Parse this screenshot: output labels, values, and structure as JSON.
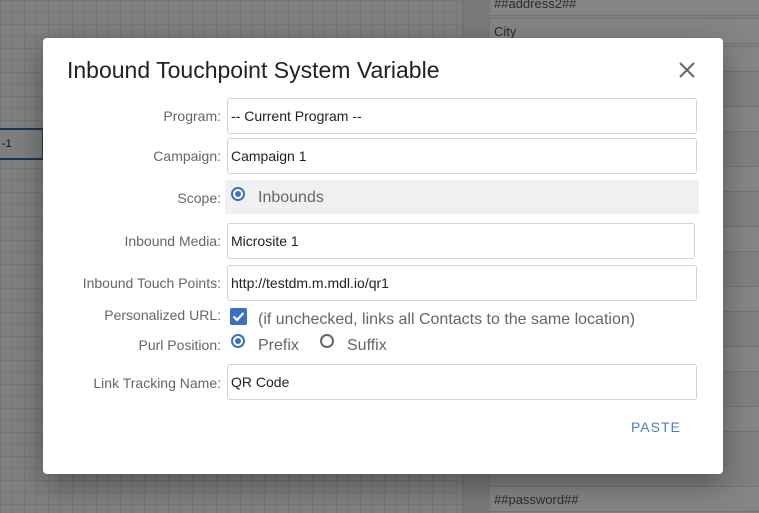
{
  "background": {
    "right_fields": [
      "##address2##",
      "City",
      "",
      "",
      "",
      "",
      "",
      "",
      "",
      "",
      "",
      "",
      "",
      "",
      "",
      "##password##"
    ],
    "selected_node_text": "-1"
  },
  "dialog": {
    "title": "Inbound Touchpoint System Variable",
    "close_icon": "close-icon",
    "program": {
      "label": "Program:",
      "value": "-- Current Program --"
    },
    "campaign": {
      "label": "Campaign:",
      "value": "Campaign 1"
    },
    "scope": {
      "label": "Scope:",
      "option": "Inbounds",
      "selected": true
    },
    "inbound_media": {
      "label": "Inbound Media:",
      "value": "Microsite 1"
    },
    "touch_points": {
      "label": "Inbound Touch Points:",
      "value": "http://testdm.m.mdl.io/qr1"
    },
    "purl": {
      "label": "Personalized URL:",
      "checked": true,
      "hint": "(if unchecked, links all Contacts to the same location)"
    },
    "purl_position": {
      "label": "Purl Position:",
      "prefix": "Prefix",
      "suffix": "Suffix",
      "selected": "Prefix"
    },
    "link_tracking": {
      "label": "Link Tracking Name:",
      "value": "QR Code"
    },
    "paste_label": "PASTE"
  },
  "colors": {
    "accent": "#3b6fc2",
    "link": "#4a7fc4"
  }
}
